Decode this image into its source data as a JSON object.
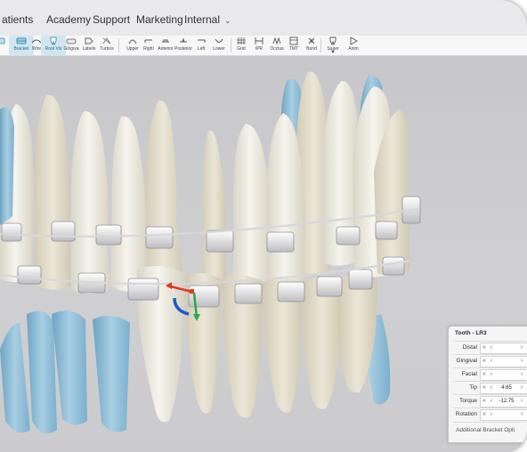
{
  "menu": {
    "items": [
      {
        "label": "atients"
      },
      {
        "label": "Academy"
      },
      {
        "label": "Support"
      },
      {
        "label": "Marketing"
      },
      {
        "label": "Internal"
      }
    ]
  },
  "toolbar": {
    "tools": [
      {
        "label": "Bracket",
        "icon": "bracket-icon"
      },
      {
        "label": "Wire",
        "icon": "wire-icon"
      },
      {
        "label": "Root Vis",
        "icon": "root-visibility-icon"
      },
      {
        "label": "Gingiva",
        "icon": "gingiva-icon"
      },
      {
        "label": "Labels",
        "icon": "tag-icon"
      },
      {
        "label": "Turbos",
        "icon": "turbo-icon"
      },
      {
        "label": "Upper",
        "icon": "upper-arch-icon"
      },
      {
        "label": "Right",
        "icon": "right-view-icon"
      },
      {
        "label": "Anterior",
        "icon": "anterior-view-icon"
      },
      {
        "label": "Posterior",
        "icon": "posterior-view-icon"
      },
      {
        "label": "Left",
        "icon": "left-view-icon"
      },
      {
        "label": "Lower",
        "icon": "lower-arch-icon"
      },
      {
        "label": "Grid",
        "icon": "grid-icon"
      },
      {
        "label": "IPR",
        "icon": "ipr-icon"
      },
      {
        "label": "Occlus",
        "icon": "occlusion-icon"
      },
      {
        "label": "TMT",
        "icon": "tooth-movement-table-icon"
      },
      {
        "label": "Bond",
        "icon": "bond-icon"
      },
      {
        "label": "Super",
        "icon": "superimpose-icon"
      },
      {
        "label": "Anim",
        "icon": "play-icon"
      }
    ],
    "active": [
      "Bracket",
      "Root Vis"
    ]
  },
  "tooth_panel": {
    "title": "Tooth - LR3",
    "rows": [
      {
        "label": "Distal",
        "value": ""
      },
      {
        "label": "Gingival",
        "value": ""
      },
      {
        "label": "Facial",
        "value": ""
      },
      {
        "label": "Tip",
        "value": "4.65"
      },
      {
        "label": "Torque",
        "value": "-12.75"
      },
      {
        "label": "Rotation",
        "value": ""
      }
    ],
    "footer": "Additional Bracket Opti"
  },
  "colors": {
    "accent": "#1f6c92",
    "axis_x": "#e03a1e",
    "axis_y": "#2aa84a",
    "axis_rotation": "#1f5ac8",
    "tooth": "#ece9df",
    "root_lower": "#8bbdd8",
    "background": "#c9c9cc"
  }
}
